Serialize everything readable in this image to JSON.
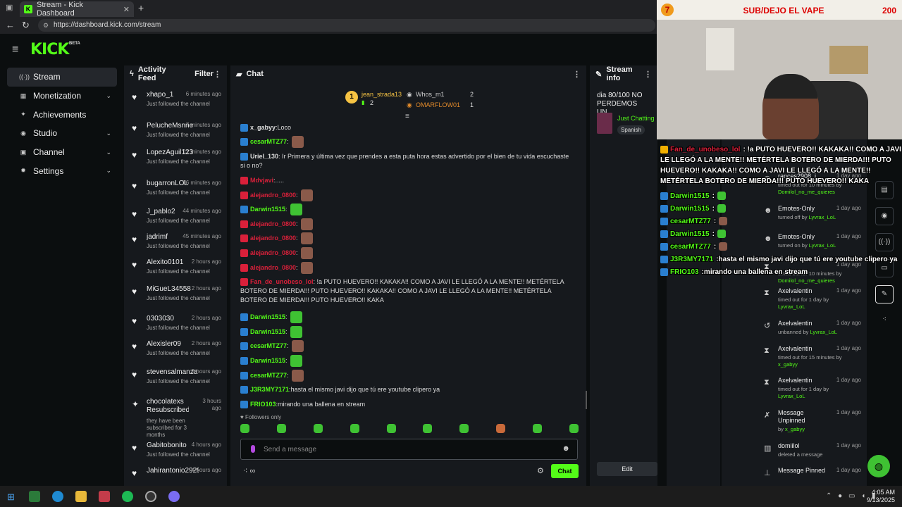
{
  "browser": {
    "tab_title": "Stream - Kick Dashboard",
    "url": "https://dashboard.kick.com/stream"
  },
  "brand": {
    "logo": "KICK",
    "badge": "BETA",
    "accent": "#53fc18"
  },
  "sidebar": {
    "items": [
      {
        "label": "Stream",
        "icon": "stream-icon",
        "active": true
      },
      {
        "label": "Monetization",
        "icon": "money-icon",
        "expandable": true
      },
      {
        "label": "Achievements",
        "icon": "trophy-icon"
      },
      {
        "label": "Studio",
        "icon": "camera-icon",
        "expandable": true
      },
      {
        "label": "Channel",
        "icon": "channel-icon",
        "expandable": true
      },
      {
        "label": "Settings",
        "icon": "gear-icon",
        "expandable": true
      }
    ]
  },
  "activity": {
    "title": "Activity Feed",
    "filter_label": "Filter",
    "items": [
      {
        "name": "xhapo_1",
        "time": "6 minutes ago",
        "text": "Just followed the channel"
      },
      {
        "name": "PelucheMsnne",
        "time": "7 minutes ago",
        "text": "Just followed the channel"
      },
      {
        "name": "LopezAguil123",
        "time": "11 minutes ago",
        "text": "Just followed the channel"
      },
      {
        "name": "bugarronLOL",
        "time": "16 minutes ago",
        "text": "Just followed the channel"
      },
      {
        "name": "J_pablo2",
        "time": "44 minutes ago",
        "text": "Just followed the channel"
      },
      {
        "name": "jadrimf",
        "time": "45 minutes ago",
        "text": "Just followed the channel"
      },
      {
        "name": "Alexito0101",
        "time": "2 hours ago",
        "text": "Just followed the channel"
      },
      {
        "name": "MiGueL34558",
        "time": "2 hours ago",
        "text": "Just followed the channel"
      },
      {
        "name": "0303030",
        "time": "2 hours ago",
        "text": "Just followed the channel"
      },
      {
        "name": "Alexisler09",
        "time": "2 hours ago",
        "text": "Just followed the channel"
      },
      {
        "name": "stevensalmanza",
        "time": "3 hours ago",
        "text": "Just followed the channel"
      },
      {
        "name": "chocolatexs Resubscribed!",
        "time": "3 hours ago",
        "text": "they have been subscribed for 3 months"
      },
      {
        "name": "Gabitobonito",
        "time": "4 hours ago",
        "text": "Just followed the channel"
      },
      {
        "name": "Jahirantonio2929",
        "time": "4 hours ago",
        "text": ""
      }
    ]
  },
  "chat": {
    "title": "Chat",
    "top_gifters": [
      {
        "rank": "1",
        "name": "jean_strada13",
        "count": "2"
      },
      {
        "name": "Whos_m1",
        "count": "2"
      },
      {
        "name": "OMARFLOW01",
        "count": "1"
      }
    ],
    "messages": [
      {
        "user": "x_gabyy",
        "color": "#ddd",
        "text": "Loco"
      },
      {
        "user": "cesarMTZ77",
        "color": "#53fc18",
        "text": ""
      },
      {
        "user": "Uriel_130",
        "color": "#ddd",
        "text": "Ir Primera y última vez que prendes a esta puta hora estas advertido por el bien de tu vida escuchaste si o no?"
      },
      {
        "user": "Mdvjavi",
        "color": "#d9203a",
        "text": "....."
      },
      {
        "user": "alejandro_0800",
        "color": "#d9203a",
        "text": ""
      },
      {
        "user": "Darwin1515",
        "color": "#53fc18",
        "text": ""
      },
      {
        "user": "alejandro_0800",
        "color": "#d9203a",
        "text": ""
      },
      {
        "user": "alejandro_0800",
        "color": "#d9203a",
        "text": ""
      },
      {
        "user": "alejandro_0800",
        "color": "#d9203a",
        "text": ""
      },
      {
        "user": "alejandro_0800",
        "color": "#d9203a",
        "text": ""
      },
      {
        "user": "Fan_de_unobeso_lol",
        "color": "#d9203a",
        "text": "!a PUTO HUEVERO!! KAKAKA!! COMO A JAVI LE LLEGÓ A LA MENTE!! METÉRTELA BOTERO DE MIERDA!!! PUTO HUEVERO!! KAKAKA!! COMO A JAVI LE LLEGÓ A LA MENTE!! METÉRTELA BOTERO DE MIERDA!!! PUTO HUEVERO!! KAKA"
      },
      {
        "user": "Darwin1515",
        "color": "#53fc18",
        "text": ""
      },
      {
        "user": "Darwin1515",
        "color": "#53fc18",
        "text": ""
      },
      {
        "user": "cesarMTZ77",
        "color": "#53fc18",
        "text": ""
      },
      {
        "user": "Darwin1515",
        "color": "#53fc18",
        "text": ""
      },
      {
        "user": "cesarMTZ77",
        "color": "#53fc18",
        "text": ""
      },
      {
        "user": "J3R3MY7171",
        "color": "#53fc18",
        "text": "hasta el mismo javi dijo que tú ere youtube clipero ya"
      },
      {
        "user": "FRIO103",
        "color": "#53fc18",
        "text": "mirando una ballena en stream"
      }
    ],
    "followers_only": "Followers only",
    "input_placeholder": "Send a message",
    "send_label": "Chat"
  },
  "stream_info": {
    "title": "Stream info",
    "stream_title": "dia 80/100 NO PERDEMOS UN...",
    "category": "Just Chatting",
    "language": "Spanish",
    "edit_label": "Edit"
  },
  "modlog": {
    "items": [
      {
        "icon": "user-icon",
        "name": "rances2908_j",
        "time": "1 day ago",
        "desc": "timed out for 10 minutes by",
        "by": "Domilol_no_me_quieres"
      },
      {
        "icon": "emote-icon",
        "name": "Emotes-Only",
        "time": "1 day ago",
        "desc": "turned off by",
        "by": "Lyvrax_LoL"
      },
      {
        "icon": "emote-icon",
        "name": "Emotes-Only",
        "time": "1 day ago",
        "desc": "turned on by",
        "by": "Lyvrax_LoL"
      },
      {
        "icon": "timeout-icon",
        "name": "",
        "time": "1 day ago",
        "desc": "timed out for 10 minutes by",
        "by": "Domilol_no_me_quieres"
      },
      {
        "icon": "hourglass-icon",
        "name": "Axelvalentin",
        "time": "1 day ago",
        "desc": "timed out for 1 day by",
        "by": "Lyvrax_LoL"
      },
      {
        "icon": "undo-icon",
        "name": "Axelvalentin",
        "time": "1 day ago",
        "desc": "unbanned by",
        "by": "Lyvrax_LoL"
      },
      {
        "icon": "hourglass-icon",
        "name": "Axelvalentin",
        "time": "1 day ago",
        "desc": "timed out for 15 minutes by",
        "by": "x_gabyy"
      },
      {
        "icon": "hourglass-icon",
        "name": "Axelvalentin",
        "time": "1 day ago",
        "desc": "timed out for 1 day by",
        "by": "Lyvrax_LoL"
      },
      {
        "icon": "unpin-icon",
        "name": "Message Unpinned",
        "time": "1 day ago",
        "desc": "by",
        "by": "x_gabyy"
      },
      {
        "icon": "trash-icon",
        "name": "domiilol",
        "time": "1 day ago",
        "desc": "deleted a message",
        "by": ""
      },
      {
        "icon": "pin-icon",
        "name": "Message Pinned",
        "time": "1 day ago",
        "desc": "",
        "by": ""
      }
    ]
  },
  "webcam": {
    "left_number": "7",
    "caption": "SUB/DEJO EL VAPE",
    "right_number": "200"
  },
  "overlay_chat": [
    {
      "user": "Fan_de_unobeso_lol",
      "color": "#d9203a",
      "text": "!a PUTO HUEVERO!! KAKAKA!! COMO A JAVI LE LLEGÓ A LA MENTE!! METÉRTELA BOTERO DE MIERDA!!! PUTO HUEVERO!! KAKAKA!! COMO A JAVI LE LLEGÓ A LA MENTE!! METÉRTELA BOTERO DE MIERDA!!! PUTO HUEVERO!! KAKA"
    },
    {
      "user": "Darwin1515",
      "color": "#53fc18",
      "text": ""
    },
    {
      "user": "Darwin1515",
      "color": "#53fc18",
      "text": ""
    },
    {
      "user": "cesarMTZ77",
      "color": "#53fc18",
      "text": ""
    },
    {
      "user": "Darwin1515",
      "color": "#53fc18",
      "text": ""
    },
    {
      "user": "cesarMTZ77",
      "color": "#53fc18",
      "text": ""
    },
    {
      "user": "J3R3MY7171",
      "color": "#53fc18",
      "text": "hasta el mismo javi dijo que tú ere youtube clipero ya"
    },
    {
      "user": "FRIO103",
      "color": "#53fc18",
      "text": "mirando una ballena en stream"
    }
  ],
  "taskbar": {
    "time": "4:05 AM",
    "date": "9/13/2025"
  }
}
